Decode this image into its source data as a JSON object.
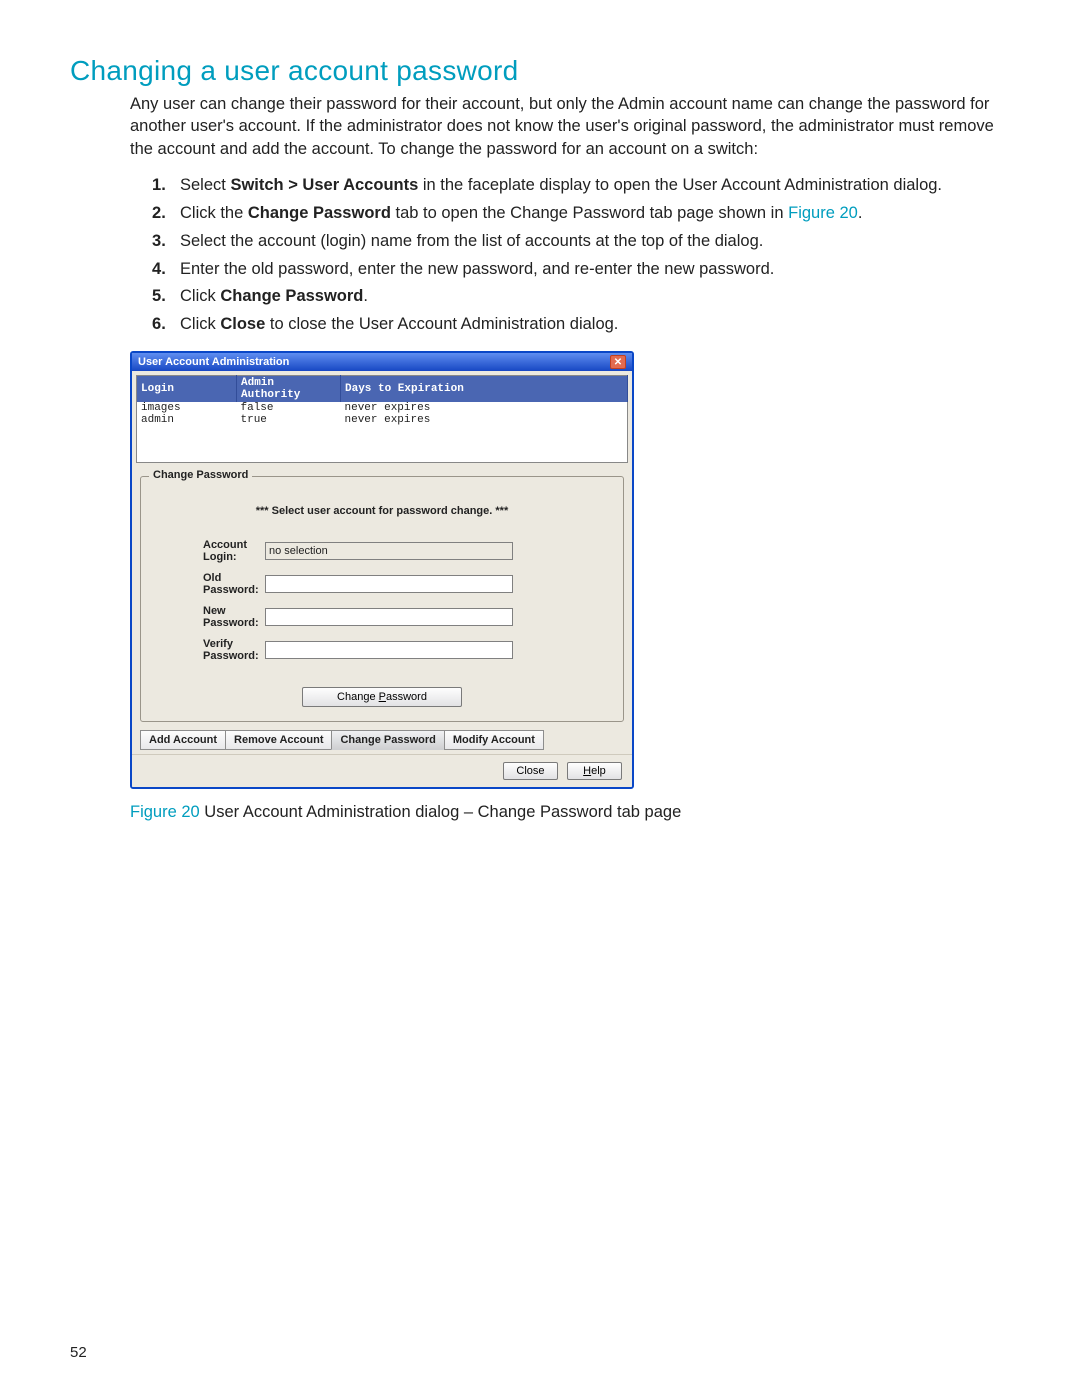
{
  "title": "Changing a user account password",
  "intro": "Any user can change their password for their account, but only the Admin account name can change the password for another user's account. If the administrator does not know the user's original password, the administrator must remove the account and add the account. To change the password for an account on a switch:",
  "steps": [
    {
      "pre": "Select ",
      "strong": "Switch > User Accounts",
      "post": " in the faceplate display to open the User Account Administration dialog."
    },
    {
      "pre": "Click the ",
      "strong": "Change Password",
      "post": " tab to open the Change Password tab page shown in ",
      "linktext": "Figure 20",
      "post2": "."
    },
    {
      "pre": "Select the account (login) name from the list of accounts at the top of the dialog.",
      "strong": "",
      "post": ""
    },
    {
      "pre": "Enter the old password, enter the new password, and re-enter the new password.",
      "strong": "",
      "post": ""
    },
    {
      "pre": "Click ",
      "strong": "Change Password",
      "post": "."
    },
    {
      "pre": "Click ",
      "strong": "Close",
      "post": " to close the User Account Administration dialog."
    }
  ],
  "dialog": {
    "title": "User Account Administration",
    "columns": {
      "login": "Login",
      "admin": "Admin Authority",
      "days": "Days to Expiration"
    },
    "rows": [
      {
        "login": "images",
        "admin": "false",
        "days": "never expires"
      },
      {
        "login": "admin",
        "admin": "true",
        "days": "never expires"
      }
    ],
    "group_title": "Change Password",
    "hint": "*** Select user account for password change. ***",
    "labels": {
      "login": "Account Login:",
      "old": "Old Password:",
      "new": "New Password:",
      "verify": "Verify Password:"
    },
    "account_login_value": "no selection",
    "change_btn": "Change Password",
    "tabs": [
      "Add Account",
      "Remove Account",
      "Change Password",
      "Modify Account"
    ],
    "selected_tab": 2,
    "close": "Close",
    "help": "Help"
  },
  "caption_label": "Figure 20",
  "caption_text": " User Account Administration dialog – Change Password tab page",
  "page_num": "52"
}
